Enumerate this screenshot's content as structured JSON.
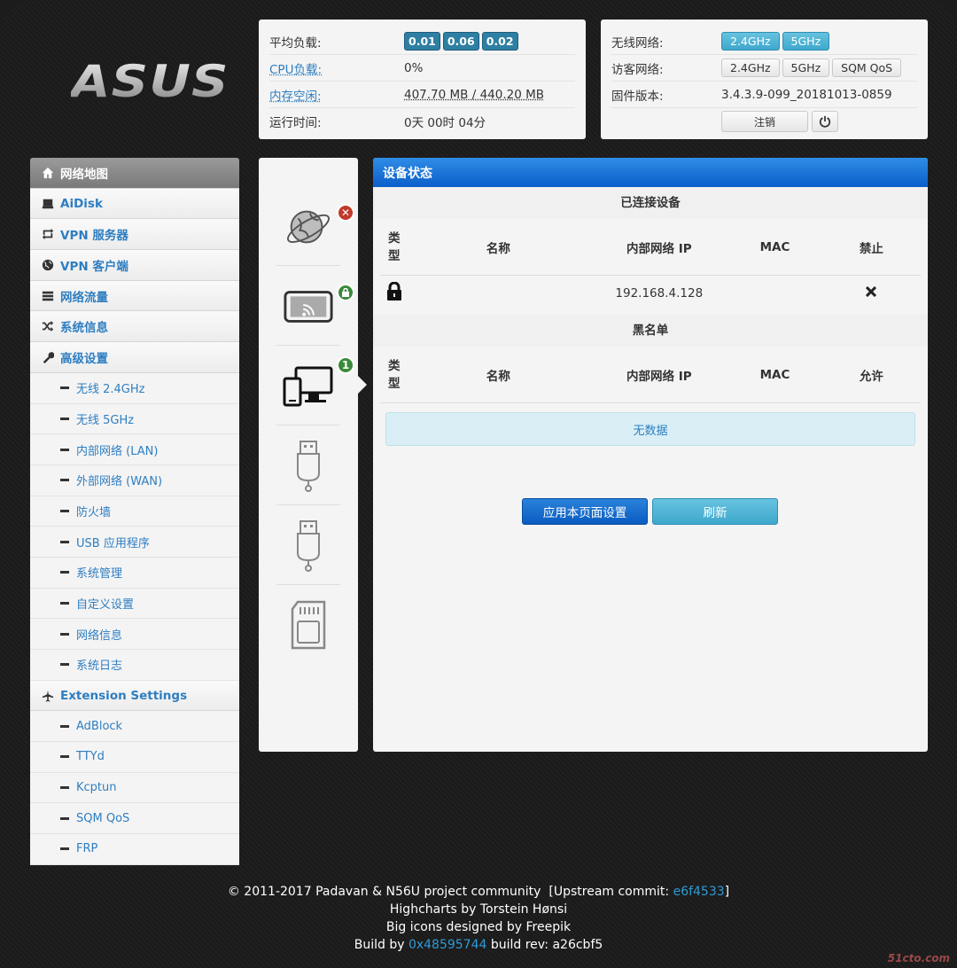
{
  "brand": {
    "logo_text": "ASUS"
  },
  "status": {
    "load_label": "平均负载:",
    "load_values": [
      "0.01",
      "0.06",
      "0.02"
    ],
    "cpu_label": "CPU负载:",
    "cpu_value": "0%",
    "mem_label": "内存空闲:",
    "mem_value": "407.70 MB / 440.20 MB",
    "uptime_label": "运行时间:",
    "uptime_value": "0天 00时 04分"
  },
  "wifi": {
    "wireless_label": "无线网络:",
    "wireless_buttons": [
      "2.4GHz",
      "5GHz"
    ],
    "guest_label": "访客网络:",
    "guest_buttons": [
      "2.4GHz",
      "5GHz",
      "SQM QoS"
    ],
    "firmware_label": "固件版本:",
    "firmware_value": "3.4.3.9-099_20181013-0859",
    "logout_label": "注销"
  },
  "sidebar": {
    "items": [
      {
        "label": "网络地图",
        "icon": "home-icon"
      },
      {
        "label": "AiDisk",
        "icon": "disk-icon"
      },
      {
        "label": "VPN 服务器",
        "icon": "retweet-icon"
      },
      {
        "label": "VPN 客户端",
        "icon": "globe-icon"
      },
      {
        "label": "网络流量",
        "icon": "storage-icon"
      },
      {
        "label": "系统信息",
        "icon": "shuffle-icon"
      },
      {
        "label": "高级设置",
        "icon": "wrench-icon"
      }
    ],
    "advanced_subitems": [
      "无线 2.4GHz",
      "无线 5GHz",
      "内部网络 (LAN)",
      "外部网络 (WAN)",
      "防火墙",
      "USB 应用程序",
      "系统管理",
      "自定义设置",
      "网络信息",
      "系统日志"
    ],
    "extension_label": "Extension Settings",
    "extension_subitems": [
      "AdBlock",
      "TTYd",
      "Kcptun",
      "SQM QoS",
      "FRP"
    ]
  },
  "icon_column": {
    "badges": {
      "clients_count": "1"
    }
  },
  "main": {
    "title": "设备状态",
    "connected_title": "已连接设备",
    "blacklist_title": "黑名单",
    "columns_type": "类型",
    "columns_type_l1": "类",
    "columns_type_l2": "型",
    "column_name": "名称",
    "column_ip": "内部网络 IP",
    "column_mac": "MAC",
    "column_ban": "禁止",
    "column_allow": "允许",
    "connected_rows": [
      {
        "ip": "192.168.4.128",
        "mac": "",
        "name": ""
      }
    ],
    "no_data": "无数据",
    "apply_label": "应用本页面设置",
    "refresh_label": "刷新"
  },
  "footer": {
    "line1_a": "© 2011-2017 Padavan & N56U project community",
    "line1_b": "[Upstream commit: ",
    "line1_commit": "e6f4533",
    "line1_c": "]",
    "line2": "Highcharts by Torstein Hønsi",
    "line3": "Big icons designed by Freepik",
    "line4_a": "Build by ",
    "line4_link": "0x48595744",
    "line4_b": " build rev: a26cbf5"
  },
  "watermark": "51cto.com"
}
